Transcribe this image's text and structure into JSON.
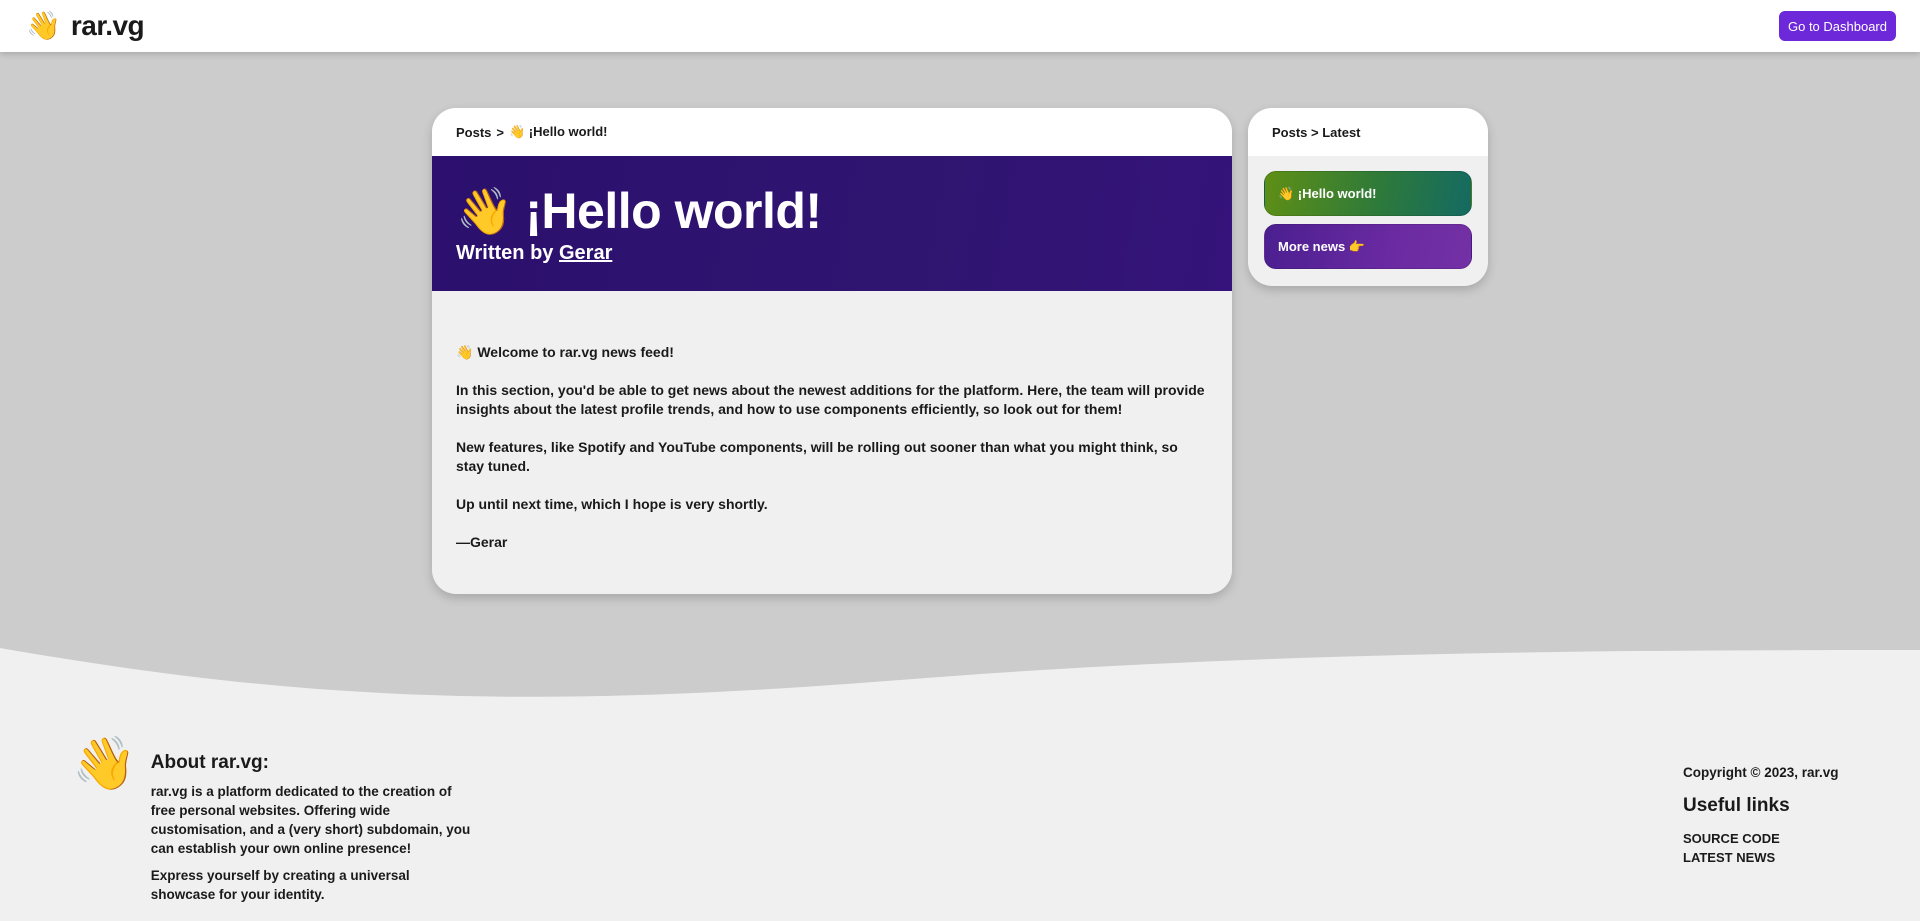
{
  "header": {
    "logo_emoji": "👋",
    "brand": "rar.vg",
    "dashboard_button": "Go to Dashboard"
  },
  "post": {
    "breadcrumb_root": "Posts",
    "breadcrumb_sep": ">",
    "breadcrumb_current": "👋 ¡Hello world!",
    "title_emoji": "👋",
    "title": "¡Hello world!",
    "author_prefix": "Written by",
    "author": "Gerar",
    "paragraphs": [
      "👋 Welcome to rar.vg news feed!",
      "In this section, you'd be able to get news about the newest additions for the platform. Here, the team will provide insights about the latest profile trends, and how to use components efficiently, so look out for them!",
      "New features, like Spotify and YouTube components, will be rolling out sooner than what you might think, so stay tuned.",
      "Up until next time, which I hope is very shortly.",
      "—Gerar"
    ]
  },
  "sidebar": {
    "breadcrumb": "Posts > Latest",
    "items": [
      {
        "label": "👋 ¡Hello world!"
      },
      {
        "label": "More news 👉"
      }
    ]
  },
  "footer": {
    "emoji": "👋",
    "about_title": "About rar.vg:",
    "about_p1": "rar.vg is a platform dedicated to the creation of free personal websites. Offering wide customisation, and a (very short) subdomain, you can establish your own online presence!",
    "about_p2": "Express yourself by creating a universal showcase for your identity.",
    "copyright": "Copyright © 2023, rar.vg",
    "links_title": "Useful links",
    "links": [
      "SOURCE CODE",
      "LATEST NEWS"
    ]
  },
  "colors": {
    "accent": "#6d28d9",
    "hero": "#2c0f6e",
    "page_bg": "#cccccc",
    "card_bg": "#f0f0f0"
  }
}
